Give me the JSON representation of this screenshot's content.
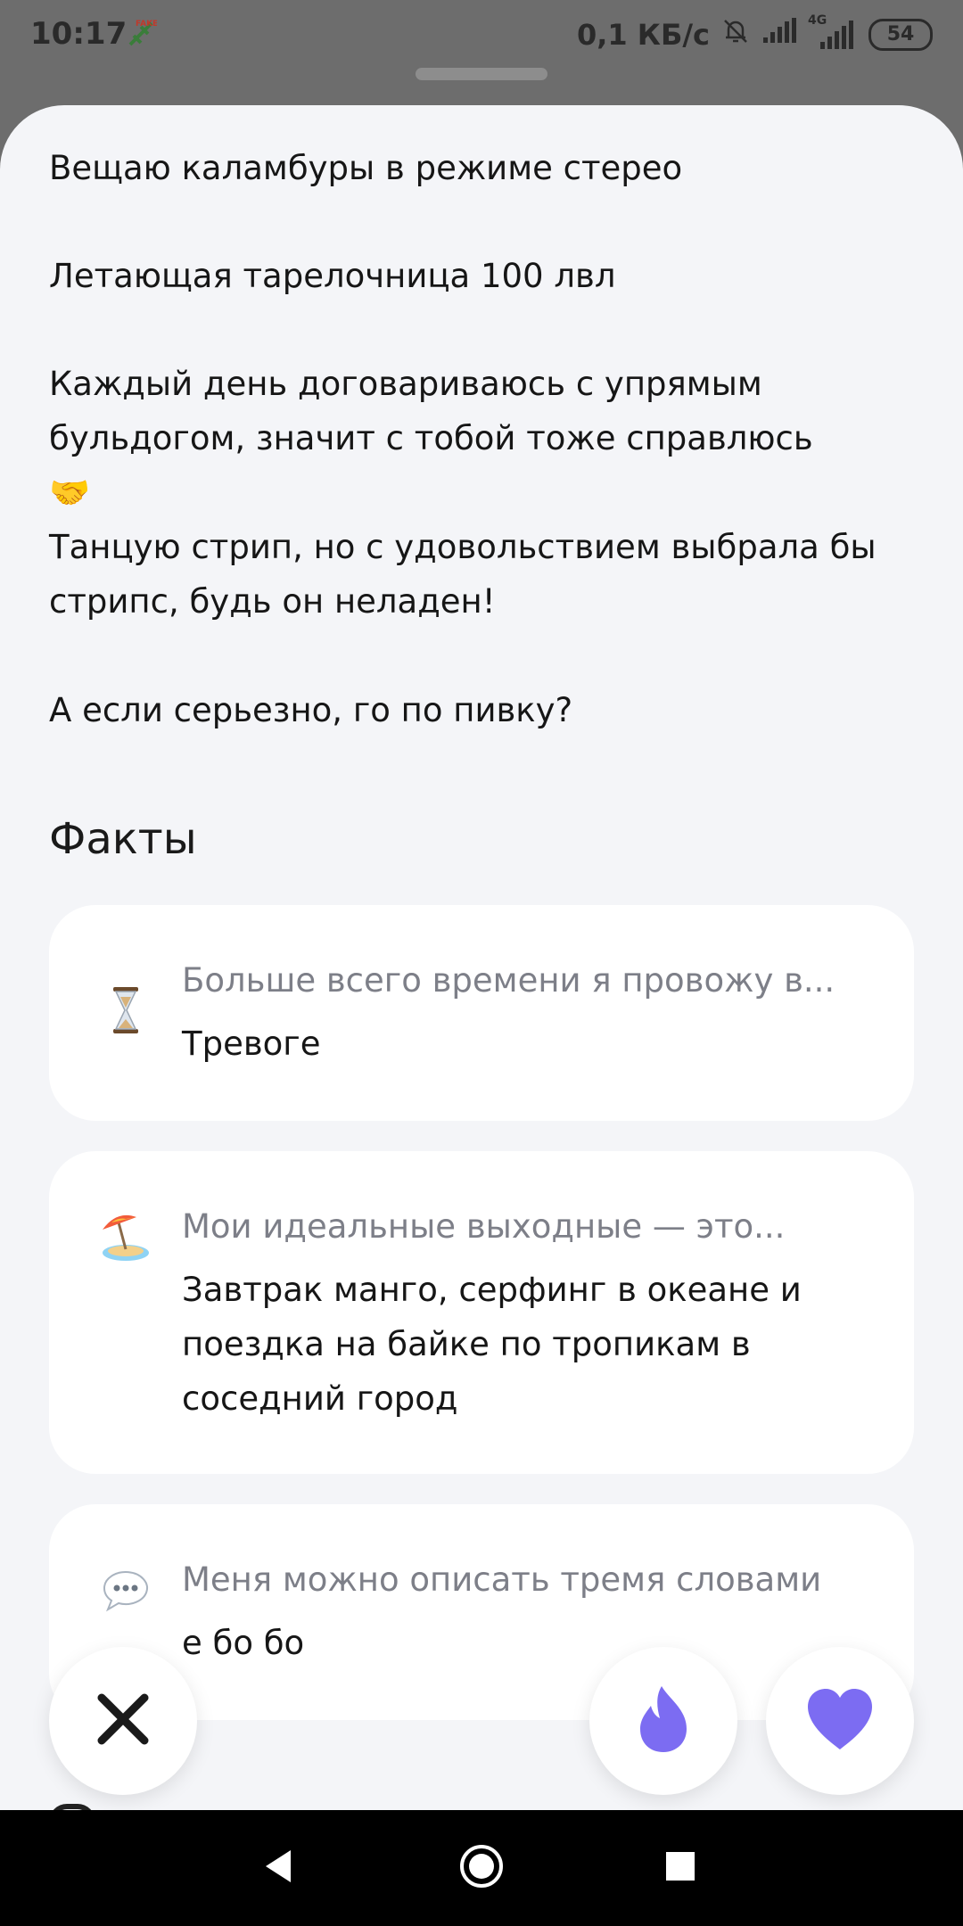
{
  "status_bar": {
    "time": "10:17",
    "fake_badge": "FAKE",
    "network_speed": "0,1 КБ/с",
    "network_type": "4G",
    "battery": "54"
  },
  "bio": {
    "lines": [
      "Вещаю каламбуры в режиме стерео",
      "Летающая тарелочница 100 лвл",
      "Каждый день договариваюсь с упрямым бульдогом, значит с тобой тоже справлюсь🤝",
      "Танцую стрип, но с удовольствием выбрала бы стрипс, будь он неладен!",
      "А если серьезно, го по пивку?"
    ]
  },
  "facts": {
    "title": "Факты",
    "items": [
      {
        "icon": "hourglass-icon",
        "question": "Больше всего времени я провожу в...",
        "answer": "Тревоге"
      },
      {
        "icon": "beach-umbrella-icon",
        "question": "Мои идеальные выходные — это...",
        "answer": "Завтрак манго, серфинг в океане и поездка на байке по тропикам в соседний город"
      },
      {
        "icon": "speech-bubble-icon",
        "question": "Меня можно описать тремя словами",
        "answer": "е бо бо"
      }
    ]
  },
  "actions": {
    "dislike": "close-icon",
    "superlike": "flame-icon",
    "like": "heart-icon",
    "accent": "#7c6cf2"
  },
  "nav": {
    "back": "back-triangle-icon",
    "home": "home-circle-icon",
    "recents": "recents-square-icon"
  }
}
